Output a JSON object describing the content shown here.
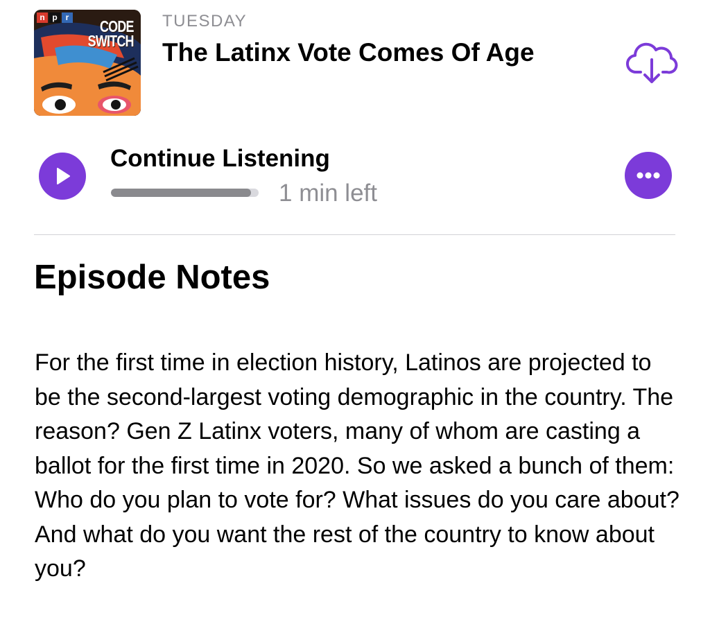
{
  "artwork": {
    "network_logo": [
      "n",
      "p",
      "r"
    ],
    "show_title_lines": [
      "CODE",
      "SWITCH"
    ]
  },
  "episode": {
    "day": "TUESDAY",
    "title": "The Latinx Vote Comes Of Age"
  },
  "playback": {
    "continue_label": "Continue Listening",
    "progress": 0.95,
    "time_left": "1 min left"
  },
  "notes": {
    "heading": "Episode Notes",
    "body": "For the first time in election history, Latinos are projected to be the second-largest voting demographic in the country. The reason? Gen Z Latinx voters, many of whom are casting a ballot for the first time in 2020. So we asked a bunch of them:  Who do you plan to vote for? What issues do you care about? And what do you want the rest of the country to know about you?"
  },
  "icons": {
    "download": "cloud-download-icon",
    "play": "play-icon",
    "more": "ellipsis-icon"
  },
  "colors": {
    "accent": "#7c3bd9",
    "secondary_text": "#8e8e93",
    "progress_fill": "#8a8a8e",
    "progress_track": "#d9d9de",
    "divider": "#d1d1d6"
  }
}
